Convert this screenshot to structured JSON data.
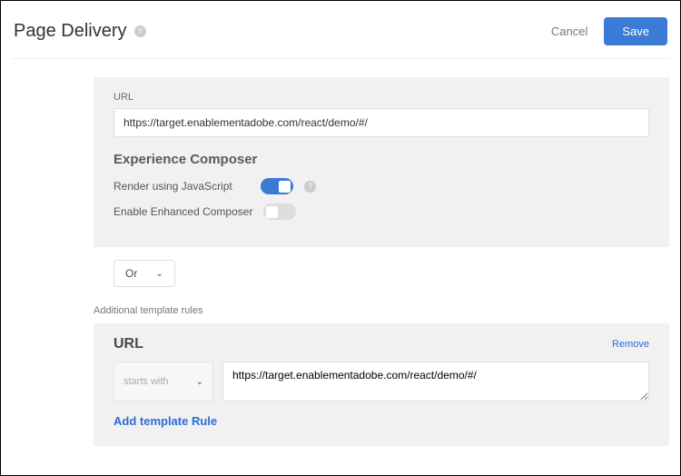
{
  "header": {
    "title": "Page Delivery",
    "cancel_label": "Cancel",
    "save_label": "Save"
  },
  "main_panel": {
    "url_label": "URL",
    "url_value": "https://target.enablementadobe.com/react/demo/#/",
    "composer_title": "Experience Composer",
    "render_js_label": "Render using JavaScript",
    "render_js_on": true,
    "enhanced_label": "Enable Enhanced Composer",
    "enhanced_on": false
  },
  "logic": {
    "operator": "Or"
  },
  "additional": {
    "heading": "Additional template rules",
    "rule": {
      "title": "URL",
      "remove_label": "Remove",
      "condition_label": "starts with",
      "value": "https://target.enablementadobe.com/react/demo/#/"
    },
    "add_label": "Add template Rule"
  }
}
